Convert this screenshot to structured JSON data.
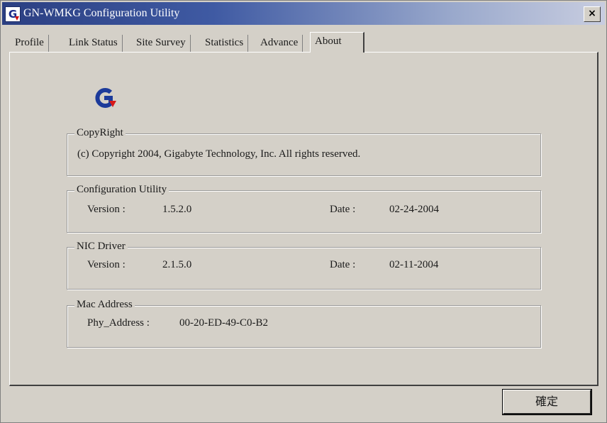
{
  "window": {
    "title": "GN-WMKG Configuration Utility",
    "close_label": "×"
  },
  "tabs": [
    {
      "label": "Profile"
    },
    {
      "label": "Link Status"
    },
    {
      "label": "Site Survey"
    },
    {
      "label": "Statistics"
    },
    {
      "label": "Advance"
    },
    {
      "label": "About",
      "active": true
    }
  ],
  "copyright": {
    "group_label": "CopyRight",
    "text": "(c) Copyright 2004, Gigabyte Technology, Inc.  All rights reserved."
  },
  "config_utility": {
    "group_label": "Configuration Utility",
    "version_label": "Version :",
    "version_value": "1.5.2.0",
    "date_label": "Date :",
    "date_value": "02-24-2004"
  },
  "nic_driver": {
    "group_label": "NIC Driver",
    "version_label": "Version :",
    "version_value": "2.1.5.0",
    "date_label": "Date :",
    "date_value": "02-11-2004"
  },
  "mac_address": {
    "group_label": "Mac Address",
    "phy_label": "Phy_Address :",
    "phy_value": "00-20-ED-49-C0-B2"
  },
  "footer": {
    "ok_label": "確定"
  },
  "colors": {
    "titlebar_start": "#2b3f82",
    "titlebar_end": "#c8cde0",
    "face": "#d4d0c8",
    "logo_blue": "#1c3a9a",
    "logo_red": "#d81818"
  }
}
